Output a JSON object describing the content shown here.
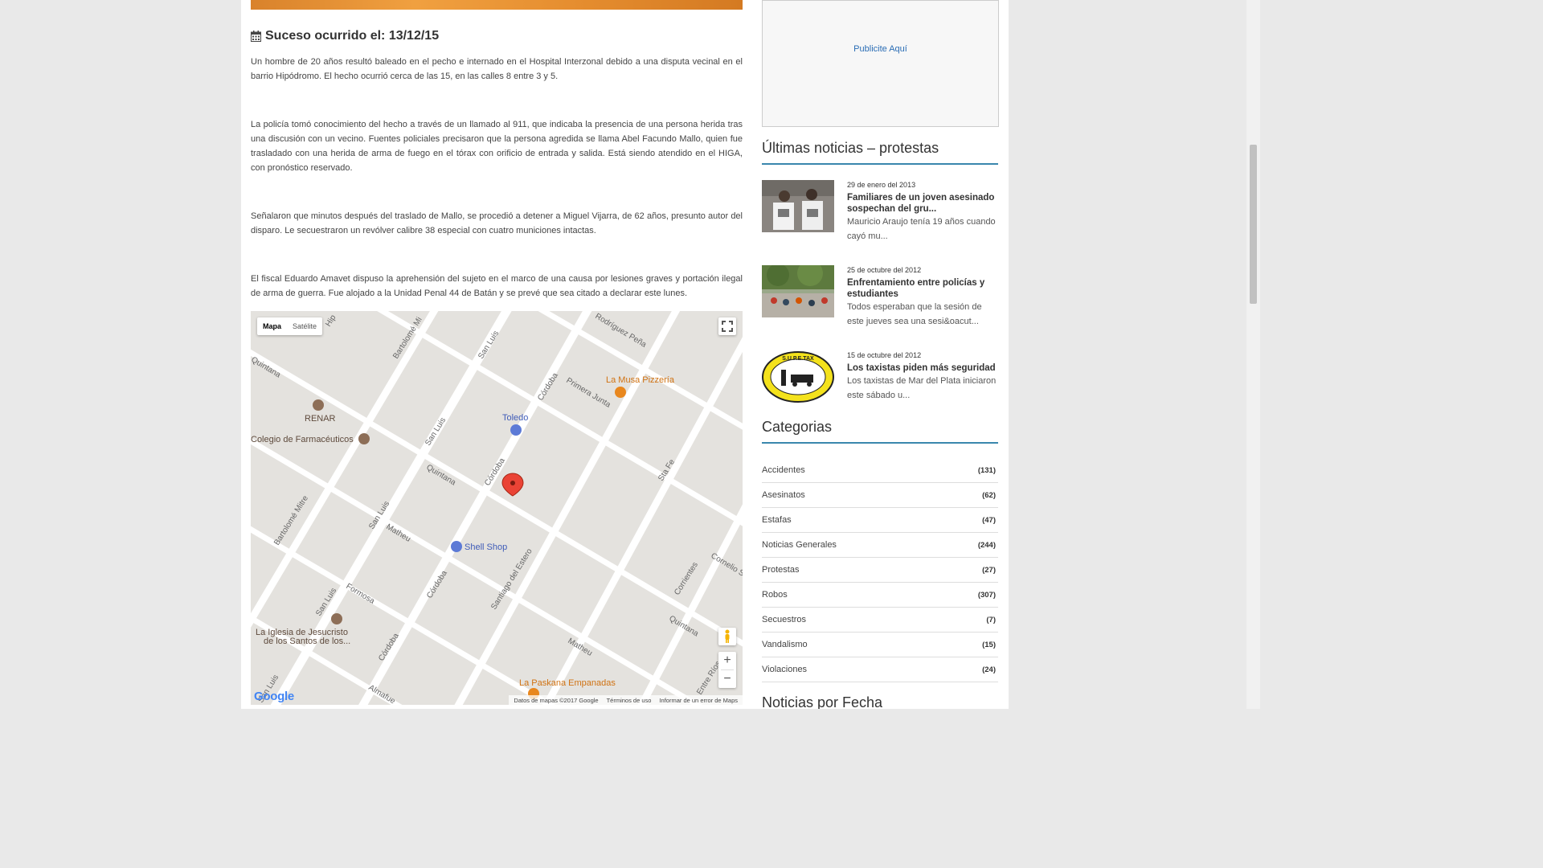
{
  "event": {
    "label": "Suceso ocurrido el: 13/12/15"
  },
  "article": {
    "paragraphs": [
      "Un hombre de 20 años resultó baleado en el pecho e internado en el Hospital Interzonal debido a una disputa vecinal en el barrio Hipódromo. El hecho ocurrió cerca de las 15, en las calles 8 entre 3 y 5.",
      "La policía tomó conocimiento del hecho a través de un llamado al 911, que indicaba la presencia de una persona herida tras una discusión con un vecino. Fuentes policiales precisaron que la persona agredida se llama Abel Facundo Mallo, quien fue trasladado con una herida de arma de fuego en el tórax con orificio de entrada y salida. Está siendo atendido en el HIGA, con pronóstico reservado.",
      "Señalaron que minutos después del traslado de Mallo, se procedió a detener a Miguel Vijarra, de 62 años, presunto autor del disparo. Le secuestraron un revólver calibre 38 especial con cuatro municiones intactas.",
      "El fiscal Eduardo Amavet dispuso la aprehensión del sujeto en el marco de una causa por lesiones graves y portación ilegal de arma de guerra. Fue alojado a la Unidad Penal 44 de Batán y se prevé que sea citado a declarar este lunes."
    ]
  },
  "map": {
    "type_map": "Mapa",
    "type_satellite": "Satélite",
    "zoom_in": "+",
    "zoom_out": "−",
    "google": "Google",
    "footer": {
      "data": "Datos de mapas ©2017 Google",
      "terms": "Términos de uso",
      "report": "Informar de un error de Maps"
    },
    "streets": {
      "hipodromo": "Hip",
      "bartolome_mitre_top": "Bartolomé Mi",
      "san_luis_top": "San Luis",
      "rodriguez_pena": "Rodríguez Peña",
      "quintana_left": "Quintana",
      "cordoba_top": "Córdoba",
      "primera_junta": "Primera Junta",
      "san_luis_mid": "San Luis",
      "quintana_mid": "Quintana",
      "cordoba_mid": "Córdoba",
      "sta_fe": "Sta Fe",
      "bartolome_mitre_left": "Bartolomé Mitre",
      "san_luis_lower": "San Luis",
      "matheu_mid": "Matheu",
      "cordoba_lower": "Córdoba",
      "santiago_del_estero": "Santiago del Estero",
      "corrientes": "Corrientes",
      "cornelio": "Cornelio S",
      "formosa": "Formosa",
      "san_luis_bottom": "San Luis",
      "cordoba_bottom": "Córdoba",
      "matheu_lower": "Matheu",
      "quintana_lower": "Quintana",
      "entre_rios": "Entre Ríos",
      "san_luis_corner": "San Luis",
      "almafuerte": "Almafue"
    },
    "places": {
      "musa": "La Musa Pizzería",
      "renar": "RENAR",
      "toledo": "Toledo",
      "colegio": "Colegio de Farmacéuticos",
      "shell": "Shell Shop",
      "iglesia_1": "La Iglesia de Jesucristo",
      "iglesia_2": "de los Santos de los...",
      "paskana": "La Paskana Empanadas"
    }
  },
  "sidebar": {
    "ad_label": "Publicite Aquí",
    "latest_title": "Últimas noticias – protestas",
    "news": [
      {
        "date": "29 de enero del 2013",
        "title": "Familiares de un joven asesinado sospechan del gru...",
        "excerpt": "Mauricio Araujo tenía 19 años cuando cayó mu..."
      },
      {
        "date": "25 de octubre del 2012",
        "title": "Enfrentamiento entre policías y estudiantes",
        "excerpt": "Todos esperaban que la sesión de este jueves sea una sesi&oacut..."
      },
      {
        "date": "15 de octubre del 2012",
        "title": "Los taxistas piden más seguridad",
        "excerpt": "Los taxistas de Mar del Plata iniciaron este sábado u..."
      }
    ],
    "categories_title": "Categorias",
    "categories": [
      {
        "name": "Accidentes",
        "count": "(131)"
      },
      {
        "name": "Asesinatos",
        "count": "(62)"
      },
      {
        "name": "Estafas",
        "count": "(47)"
      },
      {
        "name": "Noticias Generales",
        "count": "(244)"
      },
      {
        "name": "Protestas",
        "count": "(27)"
      },
      {
        "name": "Robos",
        "count": "(307)"
      },
      {
        "name": "Secuestros",
        "count": "(7)"
      },
      {
        "name": "Vandalismo",
        "count": "(15)"
      },
      {
        "name": "Violaciones",
        "count": "(24)"
      }
    ],
    "date_title": "Noticias por Fecha",
    "taxi_logo_text": "S.U.P.E.TAX"
  },
  "colors": {
    "accent_border": "#3a87ad",
    "link": "#2a6db5",
    "map_pin": "#ea4335",
    "poi_orange": "#e8871e",
    "poi_blue": "#5c7ad6",
    "poi_brown": "#8d6e57"
  }
}
